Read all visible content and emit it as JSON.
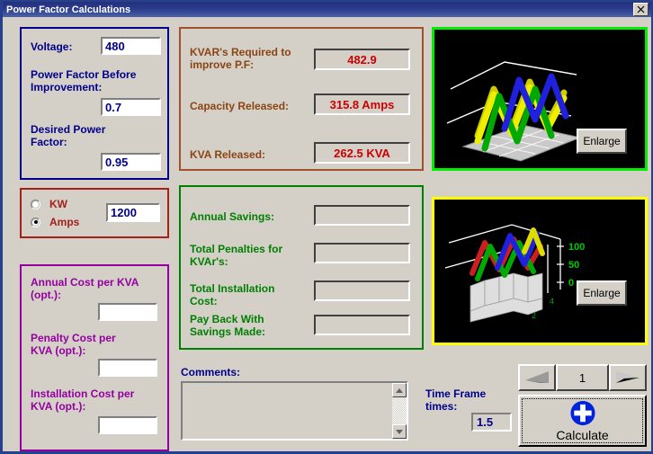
{
  "window": {
    "title": "Power Factor Calculations",
    "close_label": "✕"
  },
  "inputs_panel": {
    "voltage_label": "Voltage:",
    "voltage_value": "480",
    "pf_before_label": "Power Factor Before\nImprovement:",
    "pf_before_value": "0.7",
    "pf_desired_label": "Desired Power\nFactor:",
    "pf_desired_value": "0.95"
  },
  "load_panel": {
    "kw_label": "KW",
    "amps_label": "Amps",
    "selected": "Amps",
    "load_value": "1200"
  },
  "cost_panel": {
    "annual_cost_label": "Annual Cost per KVA\n(opt.):",
    "annual_cost_value": "",
    "penalty_cost_label": "Penalty Cost per\nKVA (opt.):",
    "penalty_cost_value": "",
    "installation_cost_label": "Installation Cost per\nKVA (opt.):",
    "installation_cost_value": ""
  },
  "results_panel": {
    "kvar_label": "KVAR's Required to\nimprove P.F:",
    "kvar_value": "482.9",
    "capacity_label": "Capacity Released:",
    "capacity_value": "315.8 Amps",
    "kva_label": "KVA Released:",
    "kva_value": "262.5 KVA"
  },
  "savings_panel": {
    "annual_savings_label": "Annual Savings:",
    "annual_savings_value": "",
    "penalties_label": "Total Penalties for\nKVAr's:",
    "penalties_value": "",
    "installation_label": "Total Installation\nCost:",
    "installation_value": "",
    "payback_label": "Pay Back With\nSavings Made:",
    "payback_value": ""
  },
  "comments": {
    "label": "Comments:",
    "value": ""
  },
  "time_frame": {
    "label": "Time Frame\ntimes:",
    "value": "1.5"
  },
  "navigator": {
    "prev_label": "◀",
    "page_value": "1",
    "next_label": "▶"
  },
  "calculate": {
    "label": "Calculate"
  },
  "charts": {
    "top": {
      "enlarge_label": "Enlarge",
      "border_color": "#00ee00"
    },
    "bottom": {
      "enlarge_label": "Enlarge",
      "border_color": "#ffff00",
      "axis_labels": [
        "100",
        "50",
        "0"
      ],
      "depth_labels": [
        "4",
        "2"
      ]
    }
  }
}
